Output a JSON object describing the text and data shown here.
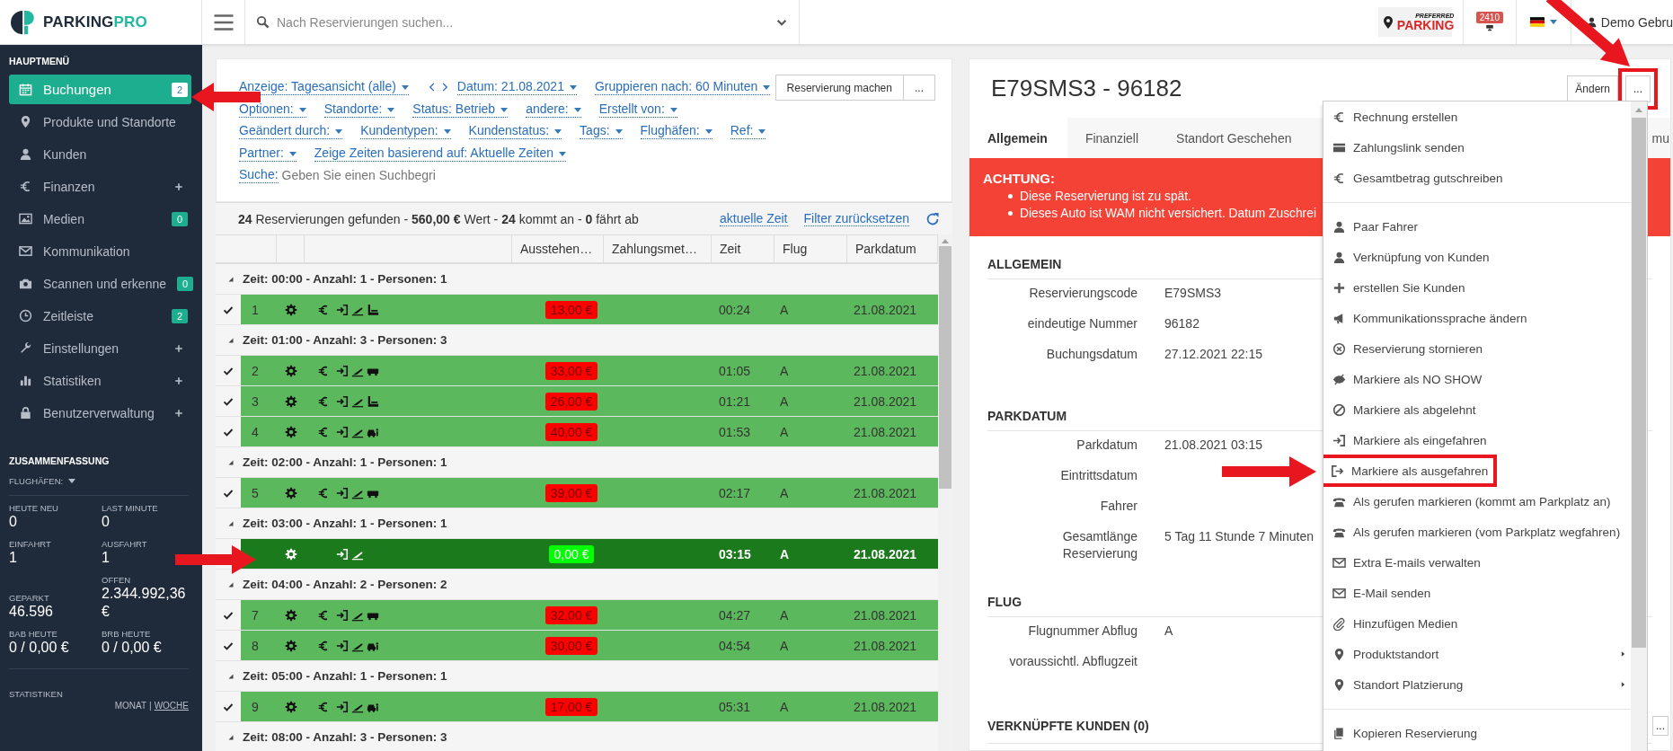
{
  "logo": {
    "text": "PARKING",
    "accent": "PRO"
  },
  "topbar": {
    "search_placeholder": "Nach Reservierungen suchen...",
    "partner_logo": {
      "small": "PREFERRED",
      "large": "PARKING"
    },
    "notification_count": "2410",
    "user": "Demo Gebru"
  },
  "sidebar": {
    "heading": "HAUPTMENÜ",
    "items": [
      {
        "label": "Buchungen",
        "selected": true,
        "badge": "2",
        "expandable": false
      },
      {
        "label": "Produkte und Standorte",
        "selected": false,
        "expandable": false
      },
      {
        "label": "Kunden",
        "selected": false,
        "expandable": false
      },
      {
        "label": "Finanzen",
        "selected": false,
        "expandable": true
      },
      {
        "label": "Medien",
        "selected": false,
        "badge": "0",
        "expandable": false
      },
      {
        "label": "Kommunikation",
        "selected": false,
        "expandable": false
      },
      {
        "label": "Scannen und erkenne",
        "selected": false,
        "badge": "0",
        "expandable": false
      },
      {
        "label": "Zeitleiste",
        "selected": false,
        "badge": "2",
        "expandable": false
      },
      {
        "label": "Einstellungen",
        "selected": false,
        "expandable": true
      },
      {
        "label": "Statistiken",
        "selected": false,
        "expandable": true
      },
      {
        "label": "Benutzerverwaltung",
        "selected": false,
        "expandable": true
      }
    ],
    "summary": {
      "heading": "ZUSAMMENFASSUNG",
      "filter": "FLUGHÄFEN:",
      "stats": [
        {
          "label": "HEUTE NEU",
          "value": "0"
        },
        {
          "label": "EINFAHRT",
          "value": "1"
        },
        {
          "label": "GEPARKT",
          "value": "46.596"
        },
        {
          "label": "BAB HEUTE",
          "value": "0 / 0,00 €"
        },
        {
          "label": "LAST MINUTE",
          "value": "0"
        },
        {
          "label": "AUSFAHRT",
          "value": "1"
        },
        {
          "label": "OFFEN",
          "value": "2.344.992,36 €"
        },
        {
          "label": "BRB HEUTE",
          "value": "0 / 0,00 €"
        }
      ]
    },
    "statistics": {
      "heading": "STATISTIKEN",
      "separator": "|",
      "periods": [
        {
          "label": "MONAT",
          "selected": true
        },
        {
          "label": "WOCHE",
          "selected": false
        }
      ]
    }
  },
  "filters": {
    "rows": [
      [
        {
          "kind": "dropdown",
          "label": "Anzeige: Tagesansicht (alle)"
        },
        {
          "kind": "pager"
        },
        {
          "kind": "dropdown",
          "label": "Datum: 21.08.2021"
        },
        {
          "kind": "dropdown",
          "label": "Gruppieren nach: 60 Minuten"
        }
      ],
      [
        {
          "kind": "dropdown",
          "label": "Optionen:"
        },
        {
          "kind": "dropdown",
          "label": "Standorte:"
        },
        {
          "kind": "dropdown",
          "label": "Status: Betrieb"
        },
        {
          "kind": "dropdown",
          "label": "andere:"
        },
        {
          "kind": "dropdown",
          "label": "Erstellt von:"
        }
      ],
      [
        {
          "kind": "dropdown",
          "label": "Geändert durch:"
        },
        {
          "kind": "dropdown",
          "label": "Kundentypen:"
        },
        {
          "kind": "dropdown",
          "label": "Kundenstatus:"
        },
        {
          "kind": "dropdown",
          "label": "Tags:"
        },
        {
          "kind": "dropdown",
          "label": "Flughäfen:"
        },
        {
          "kind": "dropdown",
          "label": "Ref:"
        }
      ],
      [
        {
          "kind": "dropdown",
          "label": "Partner:"
        },
        {
          "kind": "dropdown",
          "label": "Zeige Zeiten basierend auf: Aktuelle Zeiten"
        }
      ]
    ],
    "search": {
      "label": "Suche:",
      "placeholder": "Geben Sie einen Suchbegri"
    },
    "actions": [
      "Reservierung machen",
      "..."
    ]
  },
  "results": {
    "text": "**24** Reservierungen gefunden - **560,00 €** Wert - **24** kommt an - **0** fährt ab",
    "links": [
      "aktuelle Zeit",
      "Filter zurücksetzen"
    ]
  },
  "table": {
    "columns": [
      "Ausstehen…",
      "Zahlungsmet…",
      "Zeit",
      "Flug",
      "Parkdatum"
    ],
    "groups": [
      {
        "label": "Zeit: 00:00 - Anzahl: 1 - Personen: 1",
        "expanded": true,
        "rows": [
          {
            "number": "1",
            "checked": true,
            "selected": false,
            "payment": true,
            "kind": "luggage",
            "amount": "13,00 €",
            "settled": false,
            "time": "00:24",
            "flight": "A",
            "date": "21.08.2021"
          }
        ]
      },
      {
        "label": "Zeit: 01:00 - Anzahl: 3 - Personen: 3",
        "expanded": true,
        "rows": [
          {
            "number": "2",
            "checked": true,
            "selected": false,
            "payment": true,
            "kind": "bus",
            "amount": "33,00 €",
            "settled": false,
            "time": "01:05",
            "flight": "A",
            "date": "21.08.2021"
          },
          {
            "number": "3",
            "checked": true,
            "selected": false,
            "payment": true,
            "kind": "luggage",
            "amount": "26,00 €",
            "settled": false,
            "time": "01:21",
            "flight": "A",
            "date": "21.08.2021"
          },
          {
            "number": "4",
            "checked": true,
            "selected": false,
            "payment": true,
            "kind": "car",
            "amount": "40,00 €",
            "settled": false,
            "time": "01:53",
            "flight": "A",
            "date": "21.08.2021"
          }
        ]
      },
      {
        "label": "Zeit: 02:00 - Anzahl: 1 - Personen: 1",
        "expanded": true,
        "rows": [
          {
            "number": "5",
            "checked": true,
            "selected": false,
            "payment": true,
            "kind": "bus",
            "amount": "39,00 €",
            "settled": false,
            "time": "02:17",
            "flight": "A",
            "date": "21.08.2021"
          }
        ]
      },
      {
        "label": "Zeit: 03:00 - Anzahl: 1 - Personen: 1",
        "expanded": true,
        "rows": [
          {
            "checked": false,
            "selected": true,
            "payment": false,
            "kind": "plain",
            "amount": "0,00 €",
            "settled": true,
            "time": "03:15",
            "flight": "A",
            "date": "21.08.2021"
          }
        ]
      },
      {
        "label": "Zeit: 04:00 - Anzahl: 2 - Personen: 2",
        "expanded": true,
        "rows": [
          {
            "number": "7",
            "checked": true,
            "selected": false,
            "payment": true,
            "kind": "bus",
            "amount": "32,00 €",
            "settled": false,
            "time": "04:27",
            "flight": "A",
            "date": "21.08.2021"
          },
          {
            "number": "8",
            "checked": true,
            "selected": false,
            "payment": true,
            "kind": "car",
            "amount": "30,00 €",
            "settled": false,
            "time": "04:54",
            "flight": "A",
            "date": "21.08.2021"
          }
        ]
      },
      {
        "label": "Zeit: 05:00 - Anzahl: 1 - Personen: 1",
        "expanded": true,
        "rows": [
          {
            "number": "9",
            "checked": true,
            "selected": false,
            "payment": true,
            "kind": "car",
            "amount": "17,00 €",
            "settled": false,
            "time": "05:31",
            "flight": "A",
            "date": "21.08.2021"
          }
        ]
      },
      {
        "label": "Zeit: 08:00 - Anzahl: 3 - Personen: 3",
        "expanded": true
      }
    ]
  },
  "detail": {
    "title": "E79SMS3 - 96182",
    "actions": [
      {
        "label": "Ändern",
        "highlighted": false
      },
      {
        "label": "...",
        "highlighted": true
      }
    ],
    "tabs": [
      {
        "label": "Allgemein",
        "selected": true
      },
      {
        "label": "Finanziell",
        "selected": false
      },
      {
        "label": "Standort Geschehen",
        "selected": false
      },
      {
        "label": "mu",
        "selected": false
      }
    ],
    "alert": {
      "title": "ACHTUNG:",
      "items": [
        "Diese Reservierung ist zu spät.",
        "Dieses Auto ist WAM nicht versichert. Datum Zuschrei"
      ]
    },
    "sections": [
      {
        "title": "ALLGEMEIN",
        "rows": [
          {
            "label": "Reservierungscode",
            "value": "E79SMS3"
          },
          {
            "label": "eindeutige Nummer",
            "value": "96182"
          },
          {
            "label": "Buchungsdatum",
            "value": "27.12.2021 22:15"
          }
        ]
      },
      {
        "title": "PARKDATUM",
        "rows": [
          {
            "label": "Parkdatum",
            "value": "21.08.2021 03:15"
          },
          {
            "label": "Eintrittsdatum"
          },
          {
            "label": "Fahrer"
          },
          {
            "label": "Gesamtlänge Reservierung",
            "value": "5 Tag 11 Stunde 7 Minuten"
          }
        ]
      },
      {
        "title": "FLUG",
        "rows": [
          {
            "label": "Flugnummer Abflug",
            "value": "A"
          },
          {
            "label": "voraussichtl. Abflugzeit"
          }
        ]
      },
      {
        "title": "VERKNÜPFTE KUNDEN (0)",
        "action": "..."
      }
    ],
    "menu": [
      [
        {
          "label": "Rechnung erstellen",
          "submenu": false,
          "highlighted": false
        },
        {
          "label": "Zahlungslink senden",
          "submenu": false,
          "highlighted": false
        },
        {
          "label": "Gesamtbetrag gutschreiben",
          "submenu": false,
          "highlighted": false
        }
      ],
      [
        {
          "label": "Paar Fahrer",
          "submenu": false,
          "highlighted": false
        },
        {
          "label": "Verknüpfung von Kunden",
          "submenu": false,
          "highlighted": false
        },
        {
          "label": "erstellen Sie Kunden",
          "submenu": false,
          "highlighted": false
        },
        {
          "label": "Kommunikationssprache ändern",
          "submenu": false,
          "highlighted": false
        },
        {
          "label": "Reservierung stornieren",
          "submenu": false,
          "highlighted": false
        },
        {
          "label": "Markiere als NO SHOW",
          "submenu": false,
          "highlighted": false
        },
        {
          "label": "Markiere als abgelehnt",
          "submenu": false,
          "highlighted": false
        },
        {
          "label": "Markiere als eingefahren",
          "submenu": false,
          "highlighted": false
        },
        {
          "label": "Markiere als ausgefahren",
          "submenu": false,
          "highlighted": true
        },
        {
          "label": "Als gerufen markieren (kommt am Parkplatz an)",
          "submenu": false,
          "highlighted": false
        },
        {
          "label": "Als gerufen markieren (vom Parkplatz wegfahren)",
          "submenu": false,
          "highlighted": false
        },
        {
          "label": "Extra E-mails verwalten",
          "submenu": false,
          "highlighted": false
        },
        {
          "label": "E-Mail senden",
          "submenu": false,
          "highlighted": false
        },
        {
          "label": "Hinzufügen Medien",
          "submenu": false,
          "highlighted": false
        },
        {
          "label": "Produktstandort",
          "submenu": true,
          "highlighted": false
        },
        {
          "label": "Standort Platzierung",
          "submenu": true,
          "highlighted": false
        }
      ],
      [
        {
          "label": "Kopieren Reservierung",
          "submenu": false,
          "highlighted": false
        }
      ]
    ]
  }
}
